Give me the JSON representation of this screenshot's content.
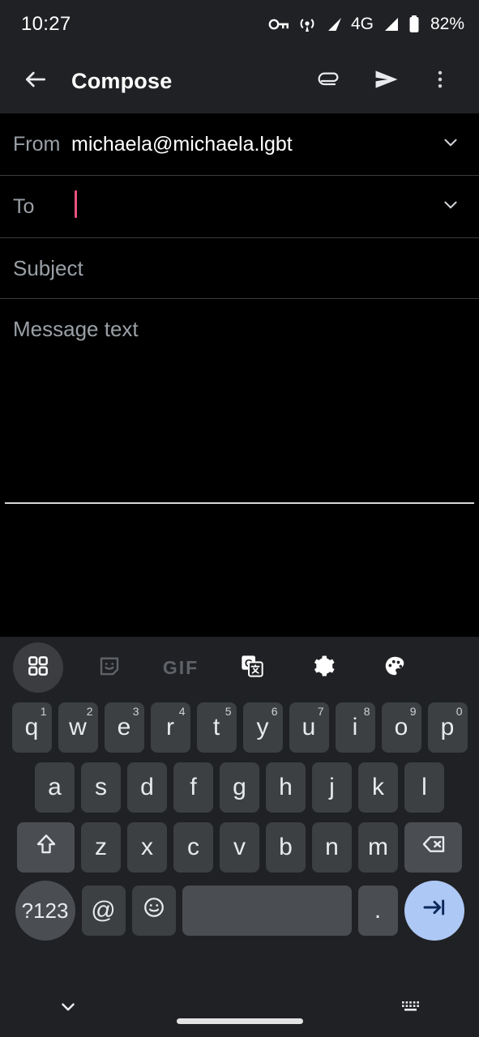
{
  "status_bar": {
    "time": "10:27",
    "network_label": "4G",
    "battery_percent": "82%",
    "icons": [
      "vpn-key-icon",
      "hotspot-icon",
      "signal-sim1-icon",
      "signal-sim2-icon",
      "battery-icon"
    ]
  },
  "toolbar": {
    "back_label": "back-arrow",
    "title": "Compose",
    "attach_label": "attach-file",
    "send_label": "send",
    "more_label": "more-options"
  },
  "compose": {
    "from_label": "From",
    "from_value": "michaela@michaela.lgbt",
    "to_label": "To",
    "to_value": "",
    "subject_placeholder": "Subject",
    "subject_value": "",
    "body_placeholder": "Message text",
    "body_value": "",
    "caret_color": "#e8517f"
  },
  "keyboard": {
    "toolbar_items": [
      {
        "name": "apps-grid-icon",
        "label": "",
        "active": true
      },
      {
        "name": "sticker-icon",
        "label": "",
        "active": false
      },
      {
        "name": "gif-icon",
        "label": "GIF",
        "active": false
      },
      {
        "name": "translate-icon",
        "label": "",
        "active": false
      },
      {
        "name": "settings-gear-icon",
        "label": "",
        "active": false
      },
      {
        "name": "theme-palette-icon",
        "label": "",
        "active": false
      }
    ],
    "row1": [
      {
        "key": "q",
        "hint": "1"
      },
      {
        "key": "w",
        "hint": "2"
      },
      {
        "key": "e",
        "hint": "3"
      },
      {
        "key": "r",
        "hint": "4"
      },
      {
        "key": "t",
        "hint": "5"
      },
      {
        "key": "y",
        "hint": "6"
      },
      {
        "key": "u",
        "hint": "7"
      },
      {
        "key": "i",
        "hint": "8"
      },
      {
        "key": "o",
        "hint": "9"
      },
      {
        "key": "p",
        "hint": "0"
      }
    ],
    "row2": [
      {
        "key": "a"
      },
      {
        "key": "s"
      },
      {
        "key": "d"
      },
      {
        "key": "f"
      },
      {
        "key": "g"
      },
      {
        "key": "h"
      },
      {
        "key": "j"
      },
      {
        "key": "k"
      },
      {
        "key": "l"
      }
    ],
    "row3": [
      {
        "key": "z"
      },
      {
        "key": "x"
      },
      {
        "key": "c"
      },
      {
        "key": "v"
      },
      {
        "key": "b"
      },
      {
        "key": "n"
      },
      {
        "key": "m"
      }
    ],
    "shift_label": "shift-key",
    "backspace_label": "backspace-key",
    "symbols_label": "?123",
    "at_label": "@",
    "emoji_label": "emoji-key",
    "space_label": "space-key",
    "period_label": ".",
    "enter_label": "next-field-key",
    "enter_color": "#aec8f5"
  },
  "nav_bar": {
    "hide_keyboard_label": "hide-keyboard",
    "home_indicator_label": "home-indicator",
    "switch_keyboard_label": "switch-keyboard"
  }
}
